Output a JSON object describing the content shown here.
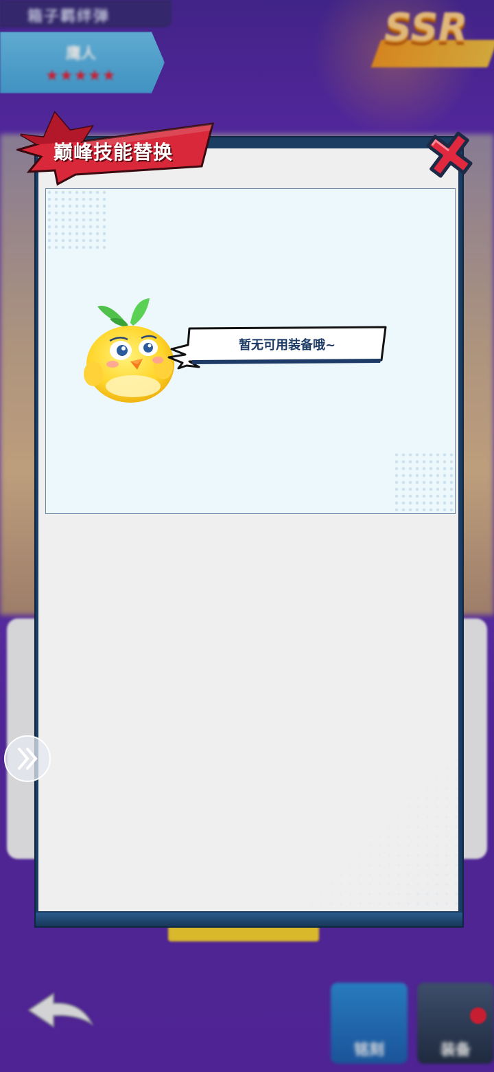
{
  "background": {
    "header_title": "箱子羁绊弹",
    "character_name": "鹰人",
    "stars": "★★★★★",
    "rarity_badge": "SSR",
    "bottom_buttons": [
      {
        "label": "铭刻"
      },
      {
        "label": "装备"
      }
    ]
  },
  "modal": {
    "title": "巅峰技能替换",
    "empty_message": "暂无可用装备哦~"
  },
  "colors": {
    "purple_bg": "#5b2aa4",
    "modal_frame": "#1c3d62",
    "title_red": "#d8283a",
    "close_red": "#e0293f",
    "content_bg": "#edf8fc"
  }
}
